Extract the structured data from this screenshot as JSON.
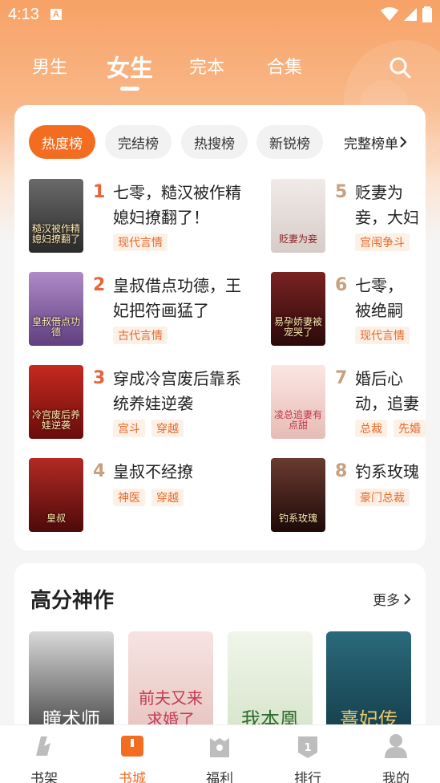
{
  "status": {
    "time": "4:13"
  },
  "tabs": [
    {
      "label": "男生"
    },
    {
      "label": "女生"
    },
    {
      "label": "完本"
    },
    {
      "label": "合集"
    }
  ],
  "chips": [
    {
      "label": "热度榜"
    },
    {
      "label": "完结榜"
    },
    {
      "label": "热搜榜"
    },
    {
      "label": "新锐榜"
    }
  ],
  "chips_more": "完整榜单",
  "rank_books": [
    {
      "rank": "1",
      "title": "七零，糙汉被作精媳妇撩翻了！",
      "tags": [
        "现代言情"
      ],
      "cover_text": "糙汉被作精媳妇撩翻了",
      "cover_color": "#3b3a3a"
    },
    {
      "rank": "2",
      "title": "皇叔借点功德，王妃把符画猛了",
      "tags": [
        "古代言情"
      ],
      "cover_text": "皇叔借点功德",
      "cover_color": "#8a6ca6"
    },
    {
      "rank": "3",
      "title": "穿成冷宫废后靠系统养娃逆袭",
      "tags": [
        "宫斗",
        "穿越"
      ],
      "cover_text": "冷宫废后养娃逆袭",
      "cover_color": "#a01818"
    },
    {
      "rank": "4",
      "title": "皇叔不经撩",
      "tags": [
        "神医",
        "穿越"
      ],
      "cover_text": "皇叔",
      "cover_color": "#8c1a1a"
    },
    {
      "rank": "5",
      "title": "贬妻为妾，大妇她",
      "tags": [
        "宫闱争斗"
      ],
      "cover_text": "贬妻为妾",
      "cover_color": "#e9e3e0"
    },
    {
      "rank": "6",
      "title": "七零，被绝嗣",
      "tags": [
        "现代言情"
      ],
      "cover_text": "易孕娇妻被宠哭了",
      "cover_color": "#4a1414"
    },
    {
      "rank": "7",
      "title": "婚后心动，追妻有",
      "tags": [
        "总裁",
        "先婚"
      ],
      "cover_text": "凌总追妻有点甜",
      "cover_color": "#f3d8d4"
    },
    {
      "rank": "8",
      "title": "钓系玫瑰",
      "tags": [
        "豪门总裁"
      ],
      "cover_text": "钓系玫瑰",
      "cover_color": "#3a1a18"
    }
  ],
  "section": {
    "title": "高分神作",
    "more": "更多"
  },
  "hi_books": [
    {
      "cover_text": "瞳术师",
      "cover_color": "#5a5a5a",
      "text_color": "#ffffff"
    },
    {
      "cover_text": "前夫又来求婚了",
      "cover_color": "#f1d9d6",
      "text_color": "#c33b55"
    },
    {
      "cover_text": "我本凰",
      "cover_color": "#e8efe0",
      "text_color": "#2f6d2f"
    },
    {
      "cover_text": "熹妃传",
      "cover_color": "#1e4d5c",
      "text_color": "#e7c76c"
    }
  ],
  "bottom_nav": [
    {
      "label": "书架",
      "icon": "bookshelf-icon"
    },
    {
      "label": "书城",
      "icon": "bookstore-icon"
    },
    {
      "label": "福利",
      "icon": "gift-icon"
    },
    {
      "label": "排行",
      "icon": "ranking-icon"
    },
    {
      "label": "我的",
      "icon": "profile-icon"
    }
  ],
  "colors": {
    "accent": "#f36d21",
    "rank_top": "#e8633a",
    "rank_other": "#c8a080"
  }
}
